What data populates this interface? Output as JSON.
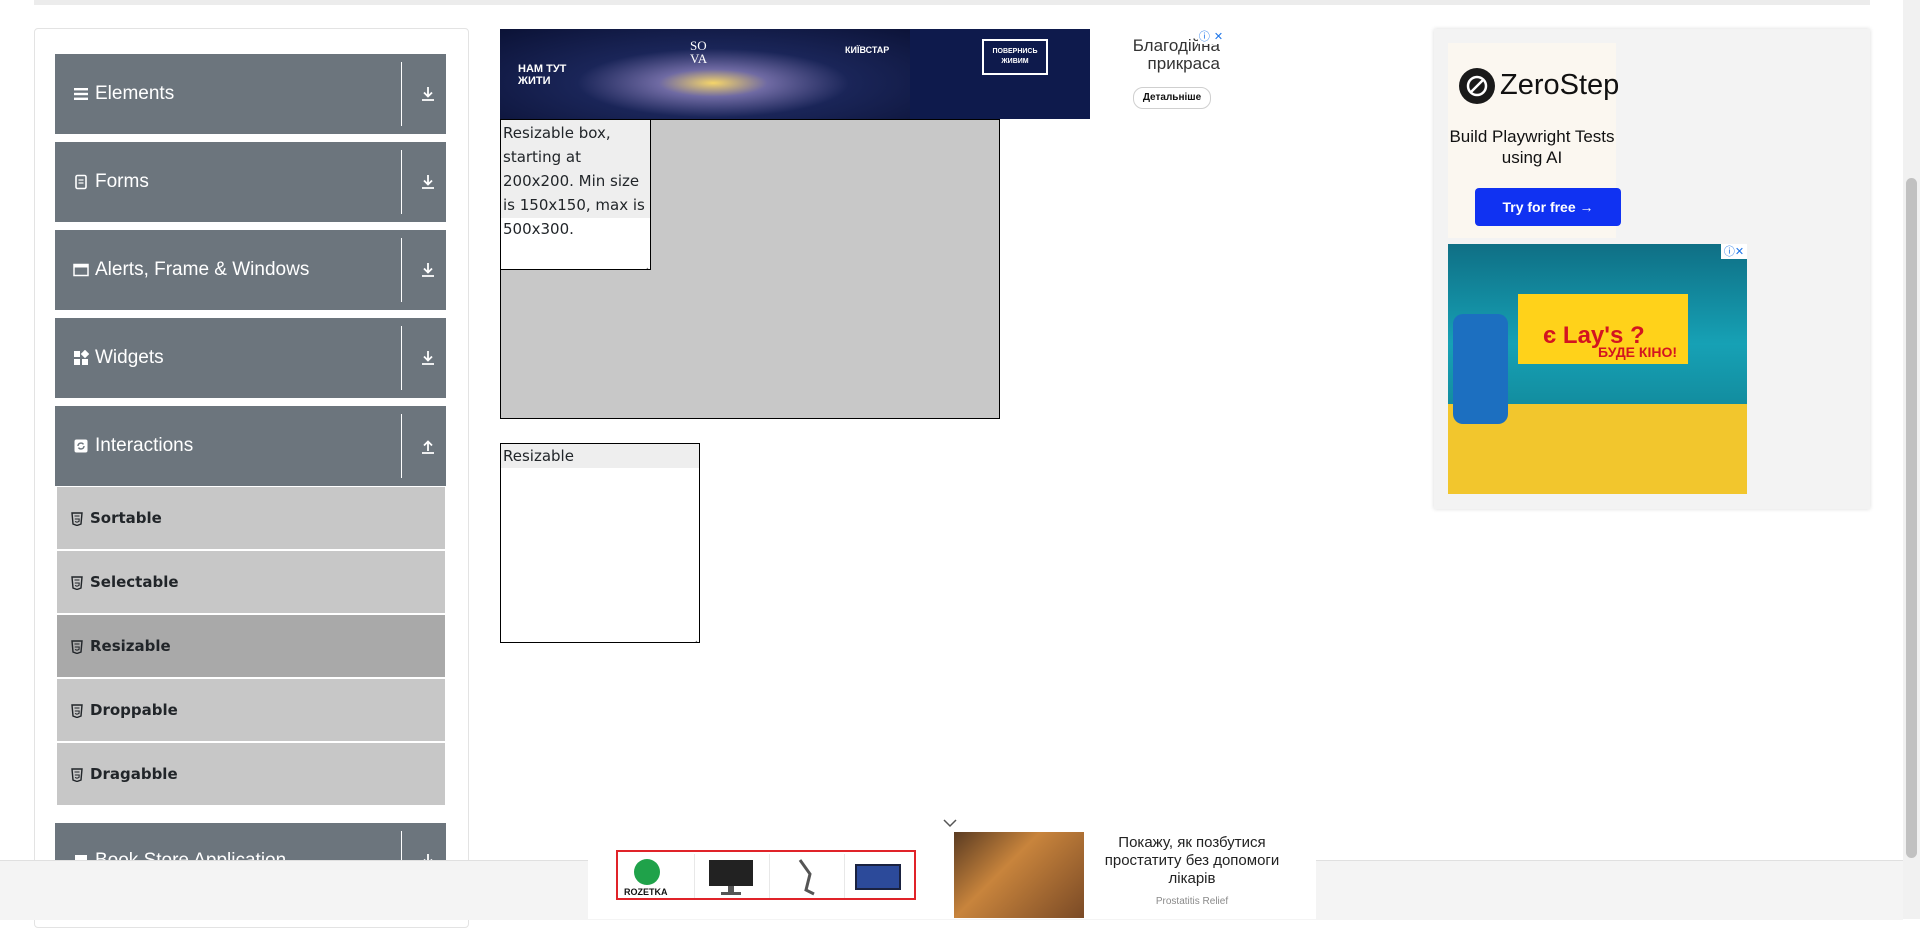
{
  "sidebar": {
    "groups": [
      {
        "label": "Elements",
        "icon": "list-icon",
        "expanded": false
      },
      {
        "label": "Forms",
        "icon": "form-icon",
        "expanded": false
      },
      {
        "label": "Alerts, Frame & Windows",
        "icon": "window-icon",
        "expanded": false
      },
      {
        "label": "Widgets",
        "icon": "widgets-icon",
        "expanded": false
      },
      {
        "label": "Interactions",
        "icon": "interactions-icon",
        "expanded": true
      },
      {
        "label": "Book Store Application",
        "icon": "book-icon",
        "expanded": false
      }
    ],
    "interaction_items": [
      {
        "label": "Sortable",
        "active": false
      },
      {
        "label": "Selectable",
        "active": false
      },
      {
        "label": "Resizable",
        "active": true
      },
      {
        "label": "Droppable",
        "active": false
      },
      {
        "label": "Dragabble",
        "active": false
      }
    ]
  },
  "top_ad": {
    "brand_left": "НАМ ТУТ ЖИТИ",
    "brand_sova": "SO VA",
    "brand_kyivstar": "КИЇВСТАР",
    "badge": "ПОВЕРНИСЬ ЖИВИМ",
    "headline": "Благодійна прикраса",
    "cta": "Детальніше"
  },
  "main": {
    "box_constrained_text": "Resizable box, starting at 200x200. Min size is 150x150, max is 500x300.",
    "box_free_text": "Resizable"
  },
  "right_ads": {
    "zerostep": {
      "name": "ZeroStep",
      "tagline": "Build Playwright Tests using AI",
      "cta": "Try for free →"
    },
    "lays": {
      "text_main": "є Lay's ?",
      "text_sub": "БУДЕ КІНО!"
    }
  },
  "bottom_ad": {
    "rozetka_label": "ROZETKA",
    "promo_text": "Покажу, як позбутися простатиту без допомоги лікарів",
    "promo_source": "Prostatitis Relief"
  },
  "colors": {
    "group_header": "#6c757d",
    "menu_item": "#c7c7c7",
    "menu_item_active": "#a9a9a9",
    "constraint_area": "#c8c8c8"
  }
}
